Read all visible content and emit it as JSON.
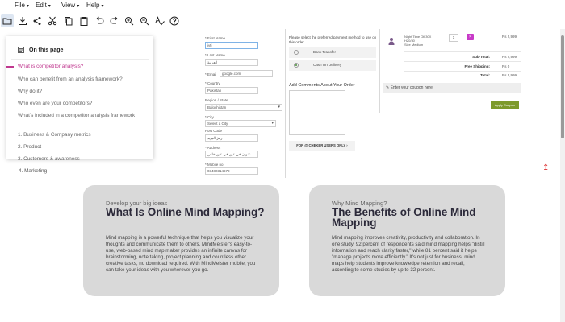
{
  "menubar": {
    "items": [
      {
        "label": "File",
        "caret": "▾"
      },
      {
        "label": "Edit",
        "caret": "▾"
      },
      {
        "label": "View",
        "caret": "▾"
      },
      {
        "label": "Help",
        "caret": "▾"
      }
    ]
  },
  "toolbar": {
    "icons": [
      "folder-icon",
      "download-icon",
      "share-icon",
      "cut-icon",
      "copy-icon",
      "paste-icon",
      "undo-icon",
      "redo-icon",
      "zoom-in-icon",
      "zoom-out-icon",
      "spellcheck-icon",
      "help-icon"
    ]
  },
  "checkout": {
    "first_name_label": "* First Name",
    "first_name_value": "jyti",
    "last_name_label": "* Last Name",
    "last_name_value": "العربية",
    "email_label": "* Email",
    "email_value": "google.com",
    "country_label": "* Country",
    "country_value": "Pakistan",
    "region_label": "Region / State",
    "region_value": "Balochistan",
    "city_label": "* City",
    "city_value": "Select a City",
    "postcode_label": "Post Code",
    "postcode_value": "رمز البريد",
    "address_label": "* Address",
    "address_value": "عنوان في عين في عين خاص",
    "mobile_label": "* Mobile no",
    "mobile_value": "03482314678",
    "payment_note": "Please select the preferred payment method to use on this order.",
    "payment_options": [
      {
        "label": "Bank Transfer",
        "checked": false
      },
      {
        "label": "Cash On Delivery",
        "checked": true
      }
    ],
    "comments_label": "Add Comments About Your Order",
    "proceed_label": "FOR @ CHEKER USERS ONLY  ›",
    "cart_item": {
      "name_line1": "Night Time Oil 30X",
      "name_line2": "H20/30",
      "name_line3": "Size Medium",
      "qty": "1",
      "remove": "×",
      "price": "Rs 2,999"
    },
    "summary": [
      {
        "label": "Sub-Total:",
        "value": "Rs 2,999"
      },
      {
        "label": "Free Shipping:",
        "value": "Rs 0"
      },
      {
        "label": "Total:",
        "value": "Rs 2,999"
      }
    ],
    "coupon_placeholder": "Enter your coupon here",
    "apply_label": "Apply Coupon",
    "scroll_top_icon": "↥"
  },
  "toc": {
    "heading": "On this page",
    "items": [
      {
        "label": "What is competitor analysis?",
        "active": true
      },
      {
        "label": "Who can benefit from an analysis framework?",
        "active": false
      },
      {
        "label": "Why do it?",
        "active": false
      },
      {
        "label": "Who even are your competitors?",
        "active": false
      },
      {
        "label": "What's included in a competitor analysis framework",
        "active": false
      },
      {
        "label": "1. Business & Company metrics",
        "active": false
      },
      {
        "label": "2. Product",
        "active": false
      },
      {
        "label": "3. Customers & awareness",
        "active": false
      }
    ],
    "below_item": "4. Marketing"
  },
  "cards": [
    {
      "eyebrow": "Develop your big ideas",
      "title": "What Is Online Mind Mapping?",
      "body": "Mind mapping is a powerful technique that helps you visualize your thoughts and communicate them to others. MindMeister's easy-to-use, web-based mind map maker provides an infinite canvas for brainstorming, note taking, project planning and countless other creative tasks, no download required. With MindMeister mobile, you can take your ideas with you wherever you go."
    },
    {
      "eyebrow": "Why Mind Mapping?",
      "title": "The Benefits of Online Mind Mapping",
      "body": "Mind mapping improves creativity, productivity and collaboration. In one study, 92 percent of respondents said mind mapping helps \"distill information and reach clarity faster,\" while 81 percent said it helps \"manage projects more efficiently.\" It's not just for business: mind maps help students improve knowledge retention and recall, according to some studies by up to 32 percent."
    }
  ]
}
